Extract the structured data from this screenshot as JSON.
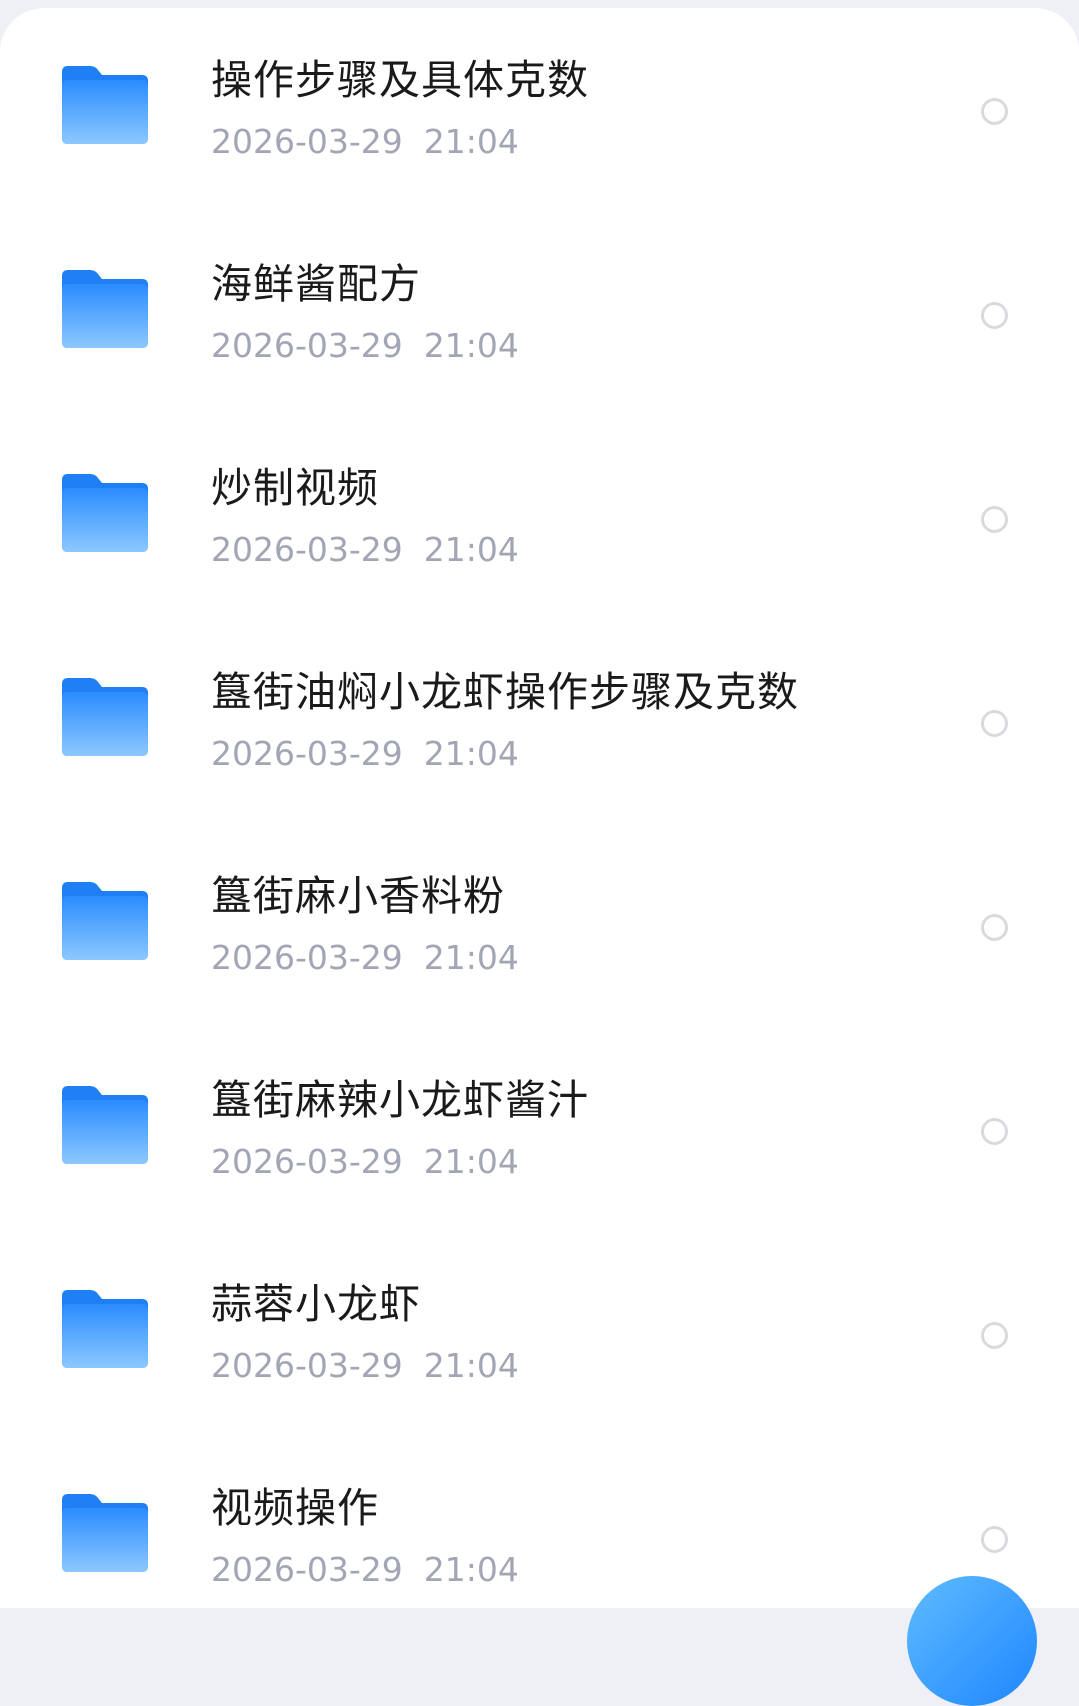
{
  "files": [
    {
      "name": "操作步骤及具体克数",
      "date": "2026-03-29  21:04",
      "icon": "folder-icon"
    },
    {
      "name": "海鲜酱配方",
      "date": "2026-03-29  21:04",
      "icon": "folder-icon"
    },
    {
      "name": "炒制视频",
      "date": "2026-03-29  21:04",
      "icon": "folder-icon"
    },
    {
      "name": "簋街油焖小龙虾操作步骤及克数",
      "date": "2026-03-29  21:04",
      "icon": "folder-icon"
    },
    {
      "name": "簋街麻小香料粉",
      "date": "2026-03-29  21:04",
      "icon": "folder-icon"
    },
    {
      "name": "簋街麻辣小龙虾酱汁",
      "date": "2026-03-29  21:04",
      "icon": "folder-icon"
    },
    {
      "name": "蒜蓉小龙虾",
      "date": "2026-03-29  21:04",
      "icon": "folder-icon"
    },
    {
      "name": "视频操作",
      "date": "2026-03-29  21:04",
      "icon": "folder-icon"
    }
  ],
  "colors": {
    "folder_top": "#2a8cff",
    "folder_bottom": "#8cc8ff",
    "date_text": "#a2a6b4",
    "fab": "#1e86ff"
  }
}
